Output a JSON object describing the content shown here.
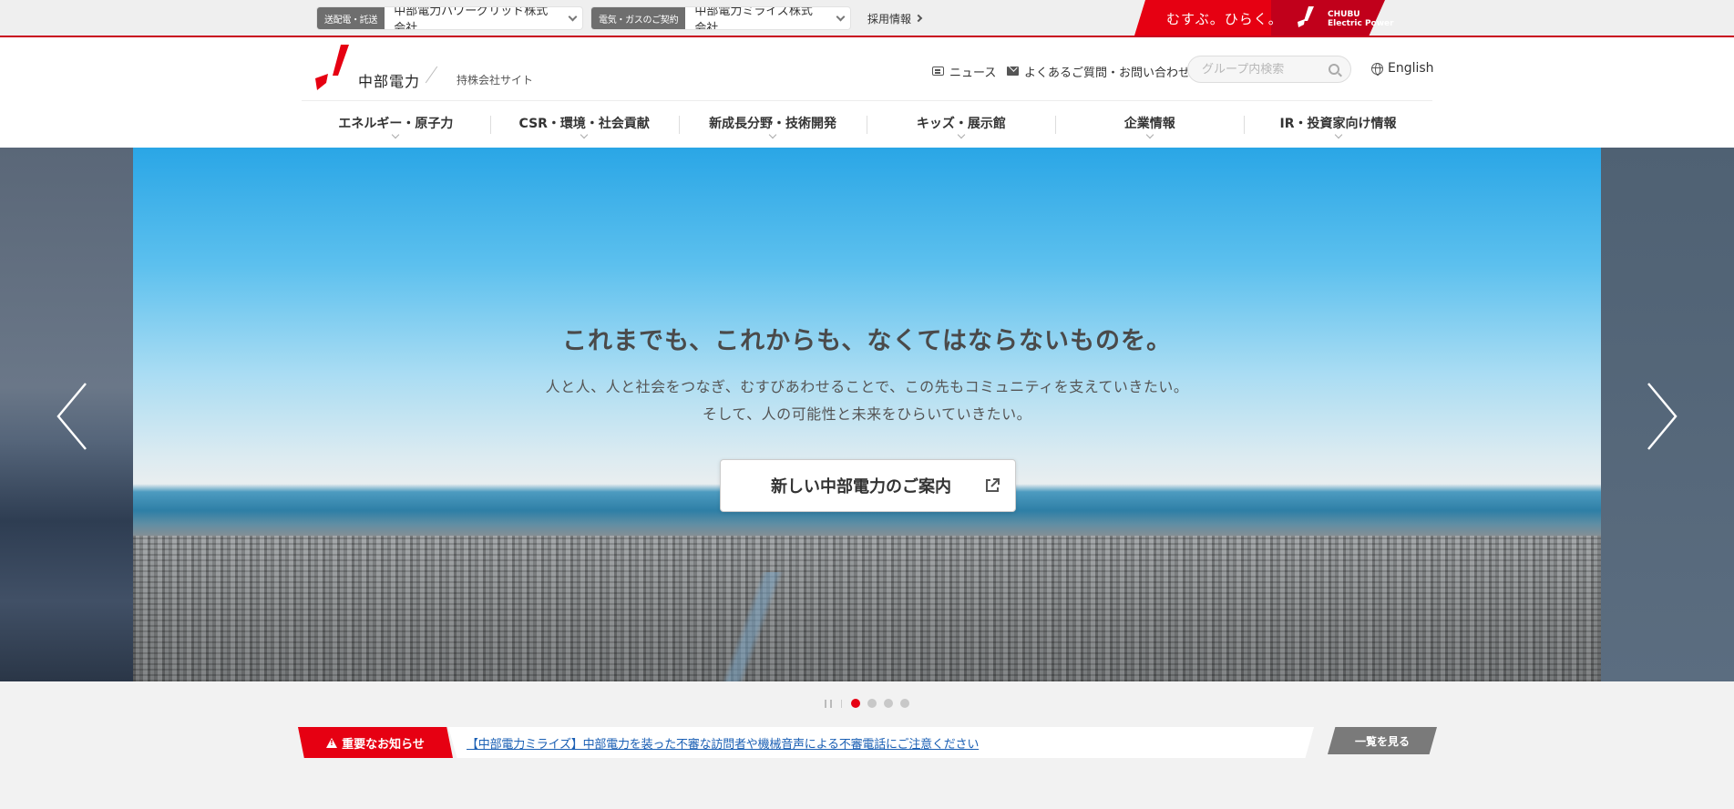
{
  "topbar": {
    "group_sites": [
      {
        "tag": "送配電・託送",
        "name": "中部電力パワーグリッド株式会社"
      },
      {
        "tag": "電気・ガスのご契約",
        "name": "中部電力ミライズ株式会社"
      }
    ],
    "recruit_label": "採用情報",
    "slogan": "むすぶ。ひらく。",
    "brand_en_line1": "CHUBU",
    "brand_en_line2": "Electric Power"
  },
  "header": {
    "logo_text": "中部電力",
    "logo_sub": "持株会社サイト",
    "news_label": "ニュース",
    "faq_label": "よくあるご質問・お問い合わせ",
    "search_placeholder": "グループ内検索",
    "english_label": "English"
  },
  "nav": {
    "items": [
      {
        "label": "エネルギー・原子力"
      },
      {
        "label": "CSR・環境・社会貢献"
      },
      {
        "label": "新成長分野・技術開発"
      },
      {
        "label": "キッズ・展示館"
      },
      {
        "label": "企業情報"
      },
      {
        "label": "IR・投資家向け情報"
      }
    ]
  },
  "hero": {
    "title": "これまでも、これからも、なくてはならないものを。",
    "sub_line1": "人と人、人と社会をつなぎ、むすびあわせることで、この先もコミュニティを支えていきたい。",
    "sub_line2": "そして、人の可能性と未来をひらいていきたい。",
    "button_label": "新しい中部電力のご案内"
  },
  "pager": {
    "total_slides": 4,
    "active_slide": 1
  },
  "notice": {
    "label": "重要なお知らせ",
    "link_text": "【中部電力ミライズ】中部電力を装った不審な訪問者や機械音声による不審電話にご注意ください",
    "more_label": "一覧を見る"
  },
  "colors": {
    "brand_red": "#e60012",
    "brand_dark_red": "#c1001b",
    "link_blue": "#1a5fb4"
  }
}
